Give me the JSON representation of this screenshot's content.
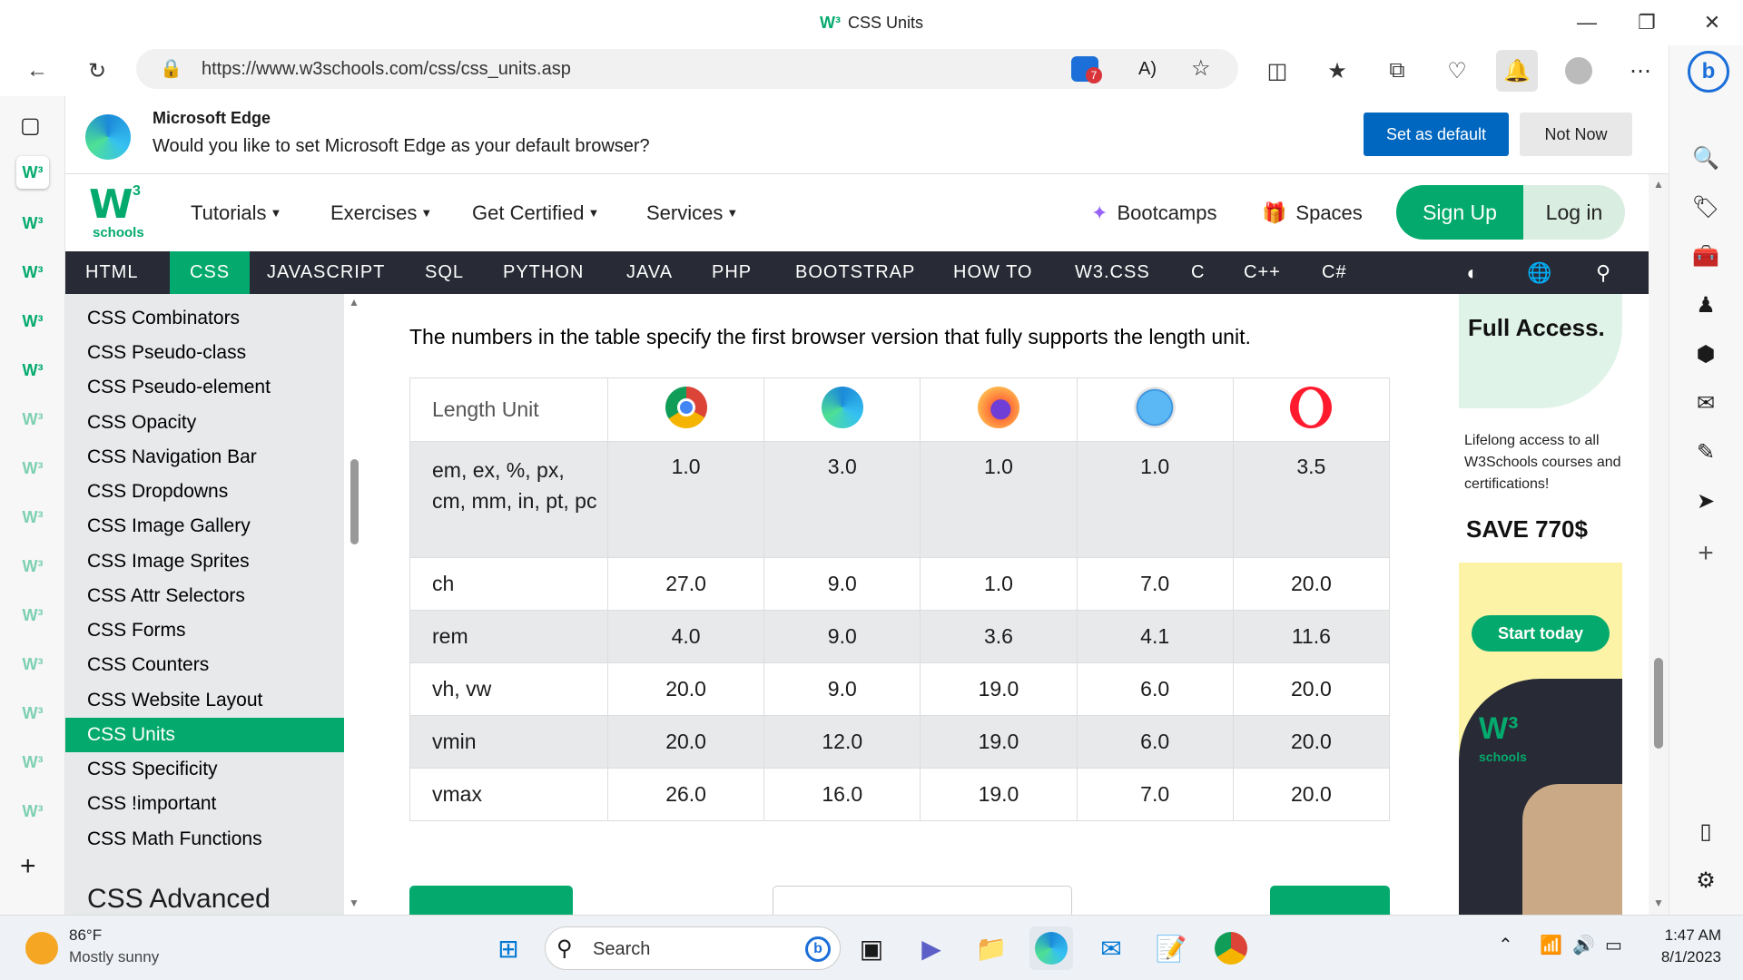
{
  "window": {
    "title": "CSS Units",
    "title_logo": "W³"
  },
  "toolbar": {
    "url": "https://www.w3schools.com/css/css_units.asp",
    "tracker_count": "7"
  },
  "infobar": {
    "title": "Microsoft Edge",
    "message": "Would you like to set Microsoft Edge as your default browser?",
    "set_default": "Set as default",
    "not_now": "Not Now"
  },
  "topnav": {
    "logo_letter": "W",
    "logo_sup": "3",
    "logo_text": "schools",
    "items": [
      {
        "label": "Tutorials"
      },
      {
        "label": "Exercises"
      },
      {
        "label": "Get Certified"
      },
      {
        "label": "Services"
      }
    ],
    "bootcamps": "Bootcamps",
    "spaces": "Spaces",
    "signup": "Sign Up",
    "login": "Log in"
  },
  "langbar": {
    "items": [
      "HTML",
      "CSS",
      "JAVASCRIPT",
      "SQL",
      "PYTHON",
      "JAVA",
      "PHP",
      "BOOTSTRAP",
      "HOW TO",
      "W3.CSS",
      "C",
      "C++",
      "C#"
    ],
    "active": "CSS"
  },
  "sidenav": {
    "items": [
      "CSS Combinators",
      "CSS Pseudo-class",
      "CSS Pseudo-element",
      "CSS Opacity",
      "CSS Navigation Bar",
      "CSS Dropdowns",
      "CSS Image Gallery",
      "CSS Image Sprites",
      "CSS Attr Selectors",
      "CSS Forms",
      "CSS Counters",
      "CSS Website Layout",
      "CSS Units",
      "CSS Specificity",
      "CSS !important",
      "CSS Math Functions"
    ],
    "active": "CSS Units",
    "section_heading": "CSS Advanced"
  },
  "content": {
    "intro": "The numbers in the table specify the first browser version that fully supports the length unit.",
    "table": {
      "header": "Length Unit",
      "browsers": [
        "Chrome",
        "Edge",
        "Firefox",
        "Safari",
        "Opera"
      ],
      "rows": [
        {
          "unit": "em, ex, %, px, cm, mm, in, pt, pc",
          "values": [
            "1.0",
            "3.0",
            "1.0",
            "1.0",
            "3.5"
          ]
        },
        {
          "unit": "ch",
          "values": [
            "27.0",
            "9.0",
            "1.0",
            "7.0",
            "20.0"
          ]
        },
        {
          "unit": "rem",
          "values": [
            "4.0",
            "9.0",
            "3.6",
            "4.1",
            "11.6"
          ]
        },
        {
          "unit": "vh, vw",
          "values": [
            "20.0",
            "9.0",
            "19.0",
            "6.0",
            "20.0"
          ]
        },
        {
          "unit": "vmin",
          "values": [
            "20.0",
            "12.0",
            "19.0",
            "6.0",
            "20.0"
          ]
        },
        {
          "unit": "vmax",
          "values": [
            "26.0",
            "16.0",
            "19.0",
            "7.0",
            "20.0"
          ]
        }
      ]
    }
  },
  "ad": {
    "headline": "Full Access.",
    "lifelong": "Lifelong access to all W3Schools courses and certifications!",
    "save": "SAVE 770$",
    "cta": "Start today",
    "logo": "W³",
    "logo_text": "schools"
  },
  "taskbar": {
    "weather_temp": "86°F",
    "weather_cond": "Mostly sunny",
    "search_placeholder": "Search",
    "time": "1:47 AM",
    "date": "8/1/2023"
  },
  "colors": {
    "accent": "#04AA6D",
    "langbar": "#282A35",
    "edge_blue": "#0067c0",
    "sidenav_bg": "#E7E9EB"
  }
}
